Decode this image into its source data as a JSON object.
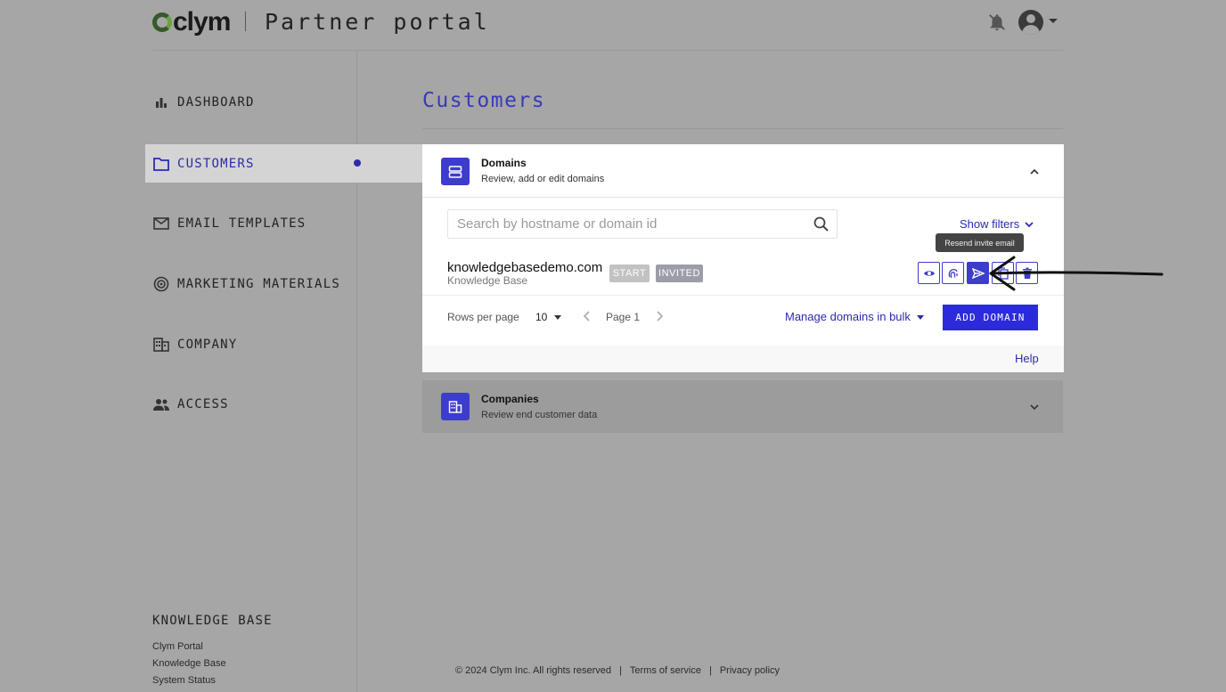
{
  "header": {
    "brand": "clym",
    "portal_title": "Partner portal"
  },
  "sidebar": {
    "items": [
      {
        "label": "DASHBOARD",
        "icon": "bar-chart-icon"
      },
      {
        "label": "CUSTOMERS",
        "icon": "folder-icon",
        "active": true
      },
      {
        "label": "EMAIL TEMPLATES",
        "icon": "envelope-icon"
      },
      {
        "label": "MARKETING MATERIALS",
        "icon": "target-icon"
      },
      {
        "label": "COMPANY",
        "icon": "building-icon"
      },
      {
        "label": "ACCESS",
        "icon": "people-icon"
      }
    ],
    "knowledge_base": {
      "title": "KNOWLEDGE BASE",
      "links": [
        "Clym Portal",
        "Knowledge Base",
        "System Status"
      ]
    }
  },
  "main": {
    "page_title": "Customers",
    "domains_panel": {
      "title": "Domains",
      "subtitle": "Review, add or edit domains",
      "search_placeholder": "Search by hostname or domain id",
      "show_filters": "Show filters",
      "tooltip": "Resend invite email",
      "rows": [
        {
          "domain": "knowledgebasedemo.com",
          "company": "Knowledge Base",
          "plan": "START",
          "status": "INVITED",
          "actions": [
            "eye-icon",
            "fingerprint-icon",
            "send-icon",
            "copy-icon",
            "delete-icon"
          ]
        }
      ],
      "rows_per_page_label": "Rows per page",
      "rows_per_page_value": "10",
      "page_label": "Page 1",
      "manage_bulk": "Manage domains in bulk",
      "add_domain": "ADD DOMAIN",
      "help": "Help"
    },
    "companies_panel": {
      "title": "Companies",
      "subtitle": "Review end customer data"
    }
  },
  "footer": {
    "copyright": "© 2024 Clym Inc. All rights reserved",
    "sep": "|",
    "terms": "Terms of service",
    "privacy": "Privacy policy"
  },
  "colors": {
    "accent": "#3d3dcc",
    "background": "#a6a6a6",
    "panel": "#ffffff"
  }
}
